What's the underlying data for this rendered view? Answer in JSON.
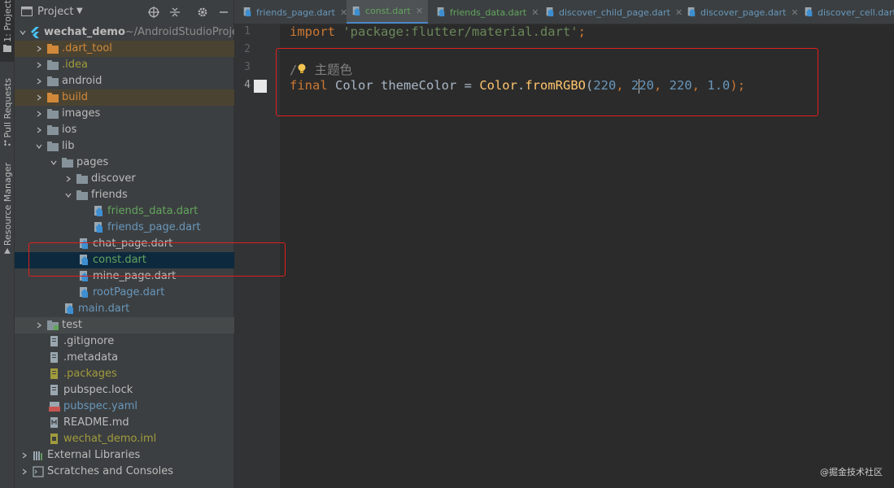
{
  "toolstrip": {
    "project_tab": "1: Project",
    "pull_requests_tab": "Pull Requests",
    "resource_manager_tab": "Resource Manager"
  },
  "project_panel": {
    "title": "Project",
    "tree": [
      {
        "label": "wechat_demo",
        "suffix": " ~/AndroidStudioProject",
        "color": "normal",
        "icon": "flutter-module-icon"
      },
      {
        "label": ".dart_tool",
        "color": "orange",
        "icon": "folder-icon"
      },
      {
        "label": ".idea",
        "color": "olive",
        "icon": "folder-icon"
      },
      {
        "label": "android",
        "color": "normal",
        "icon": "folder-icon"
      },
      {
        "label": "build",
        "color": "orange",
        "icon": "folder-icon"
      },
      {
        "label": "images",
        "color": "normal",
        "icon": "folder-icon"
      },
      {
        "label": "ios",
        "color": "normal",
        "icon": "folder-icon"
      },
      {
        "label": "lib",
        "color": "normal",
        "icon": "folder-icon"
      },
      {
        "label": "pages",
        "color": "normal",
        "icon": "folder-icon"
      },
      {
        "label": "discover",
        "color": "normal",
        "icon": "folder-icon"
      },
      {
        "label": "friends",
        "color": "normal",
        "icon": "folder-icon"
      },
      {
        "label": "friends_data.dart",
        "color": "green",
        "icon": "dart-file-icon"
      },
      {
        "label": "friends_page.dart",
        "color": "blue",
        "icon": "dart-file-icon"
      },
      {
        "label": "chat_page.dart",
        "color": "normal",
        "icon": "dart-file-icon"
      },
      {
        "label": "const.dart",
        "color": "green",
        "icon": "dart-file-icon"
      },
      {
        "label": "mine_page.dart",
        "color": "normal",
        "icon": "dart-file-icon"
      },
      {
        "label": "rootPage.dart",
        "color": "blue",
        "icon": "dart-file-icon"
      },
      {
        "label": "main.dart",
        "color": "blue",
        "icon": "dart-file-icon"
      },
      {
        "label": "test",
        "color": "normal",
        "icon": "folder-icon"
      },
      {
        "label": ".gitignore",
        "color": "normal",
        "icon": "text-file-icon"
      },
      {
        "label": ".metadata",
        "color": "normal",
        "icon": "text-file-icon"
      },
      {
        "label": ".packages",
        "color": "olive",
        "icon": "text-file-icon"
      },
      {
        "label": "pubspec.lock",
        "color": "normal",
        "icon": "text-file-icon"
      },
      {
        "label": "pubspec.yaml",
        "color": "blue",
        "icon": "yaml-file-icon"
      },
      {
        "label": "README.md",
        "color": "normal",
        "icon": "markdown-file-icon"
      },
      {
        "label": "wechat_demo.iml",
        "color": "olive",
        "icon": "module-file-icon"
      },
      {
        "label": "External Libraries",
        "color": "normal",
        "icon": "library-icon"
      },
      {
        "label": "Scratches and Consoles",
        "color": "normal",
        "icon": "scratches-icon"
      }
    ]
  },
  "tabs": [
    {
      "label": "friends_page.dart",
      "active": false
    },
    {
      "label": "const.dart",
      "active": true
    },
    {
      "label": "friends_data.dart",
      "active": false
    },
    {
      "label": "discover_child_page.dart",
      "active": false
    },
    {
      "label": "discover_page.dart",
      "active": false
    },
    {
      "label": "discover_cell.dart",
      "active": false
    }
  ],
  "editor": {
    "line_numbers": [
      "1",
      "2",
      "3",
      "4"
    ],
    "line1": {
      "keyword": "import",
      "string": "'package:flutter/material.dart'",
      "semicolon": ";"
    },
    "line3": {
      "comment_prefix": "/",
      "comment_text": " 主题色"
    },
    "line4": {
      "keyword": "final",
      "type_and_name": " Color themeColor = ",
      "class": "Color",
      "dot": ".",
      "method": "fromRGBO",
      "open": "(",
      "n1": "220",
      "sep1": ", ",
      "n2a": "2",
      "n2b": "20",
      "sep2": ", ",
      "n3": "220",
      "sep3": ", ",
      "n4": "1.0",
      "close": ");"
    }
  },
  "watermark": "@掘金技术社区",
  "colors": {
    "accent": "#4a88c7",
    "annotation": "#e0201d",
    "selected_row": "#0d293e"
  }
}
